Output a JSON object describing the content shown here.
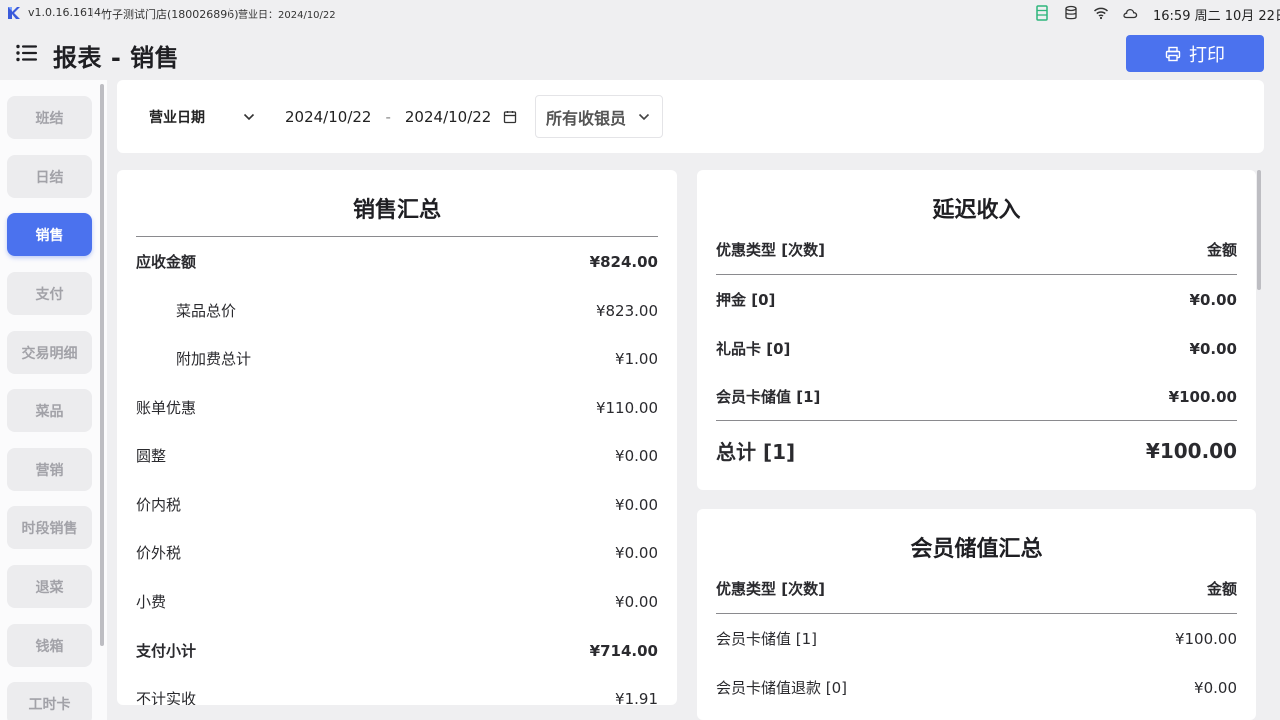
{
  "status_bar": {
    "version": "v1.0.16.1614",
    "store": "竹子测试门店(180026896)",
    "business_date": "营业日：2024/10/22",
    "time": "16:59 周二 10月 22日",
    "icons": [
      "spreadsheet-icon",
      "database-icon",
      "wifi-icon",
      "cloud-icon"
    ]
  },
  "header": {
    "title": "报表 - 销售",
    "print_label": "打印"
  },
  "sidebar": {
    "items": [
      {
        "label": "班结",
        "active": false
      },
      {
        "label": "日结",
        "active": false
      },
      {
        "label": "销售",
        "active": true
      },
      {
        "label": "支付",
        "active": false
      },
      {
        "label": "交易明细",
        "active": false
      },
      {
        "label": "菜品",
        "active": false
      },
      {
        "label": "营销",
        "active": false
      },
      {
        "label": "时段销售",
        "active": false
      },
      {
        "label": "退菜",
        "active": false
      },
      {
        "label": "钱箱",
        "active": false
      },
      {
        "label": "工时卡",
        "active": false
      }
    ]
  },
  "filters": {
    "date_type": "营业日期",
    "start_date": "2024/10/22",
    "separator": "-",
    "end_date": "2024/10/22",
    "cashier": "所有收银员"
  },
  "sales_summary": {
    "title": "销售汇总",
    "rows": [
      {
        "label": "应收金额",
        "value": "¥824.00"
      },
      {
        "label": "菜品总价",
        "value": "¥823.00"
      },
      {
        "label": "附加费总计",
        "value": "¥1.00"
      },
      {
        "label": "账单优惠",
        "value": "¥110.00"
      },
      {
        "label": "圆整",
        "value": "¥0.00"
      },
      {
        "label": "价内税",
        "value": "¥0.00"
      },
      {
        "label": "价外税",
        "value": "¥0.00"
      },
      {
        "label": "小费",
        "value": "¥0.00"
      },
      {
        "label": "支付小计",
        "value": "¥714.00"
      },
      {
        "label": "不计实收",
        "value": "¥1.91"
      }
    ]
  },
  "deferred_income": {
    "title": "延迟收入",
    "header_left": "优惠类型 [次数]",
    "header_right": "金额",
    "rows": [
      {
        "label": "押金 [0]",
        "value": "¥0.00"
      },
      {
        "label": "礼品卡 [0]",
        "value": "¥0.00"
      },
      {
        "label": "会员卡储值 [1]",
        "value": "¥100.00"
      }
    ],
    "total_label": "总计 [1]",
    "total_value": "¥100.00"
  },
  "member_recharge": {
    "title": "会员储值汇总",
    "header_left": "优惠类型 [次数]",
    "header_right": "金额",
    "rows": [
      {
        "label": "会员卡储值 [1]",
        "value": "¥100.00"
      },
      {
        "label": "会员卡储值退款 [0]",
        "value": "¥0.00"
      }
    ]
  }
}
